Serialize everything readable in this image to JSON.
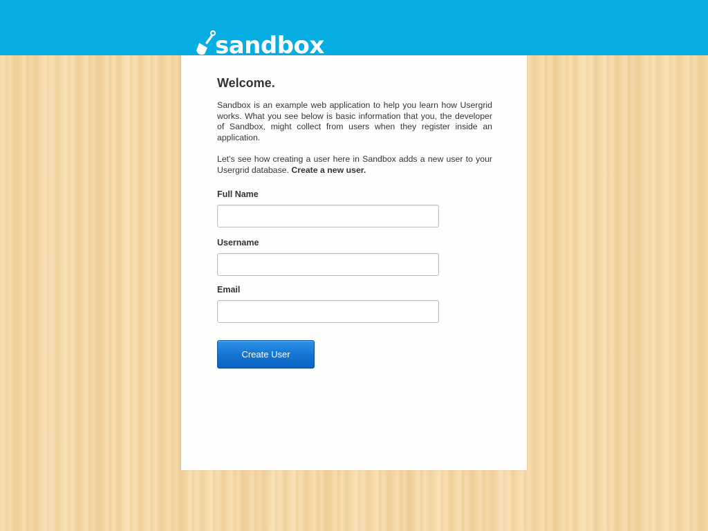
{
  "header": {
    "logo_text": "sandbox",
    "logo_icon": "shovel-icon",
    "background_color": "#06ade2"
  },
  "panel": {
    "heading": "Welcome.",
    "intro_paragraph": "Sandbox is an example web application to help you learn how Usergrid works. What you see below is basic information that you, the developer of Sandbox, might collect from users when they register inside an application.",
    "intro2_text": "Let's see how creating a user here in Sandbox adds a new user to your Usergrid database. ",
    "intro2_bold": "Create a new user."
  },
  "form": {
    "fields": [
      {
        "label": "Full Name",
        "value": "",
        "placeholder": ""
      },
      {
        "label": "Username",
        "value": "",
        "placeholder": ""
      },
      {
        "label": "Email",
        "value": "",
        "placeholder": ""
      }
    ],
    "submit_label": "Create User",
    "button_color": "#1576d4"
  }
}
